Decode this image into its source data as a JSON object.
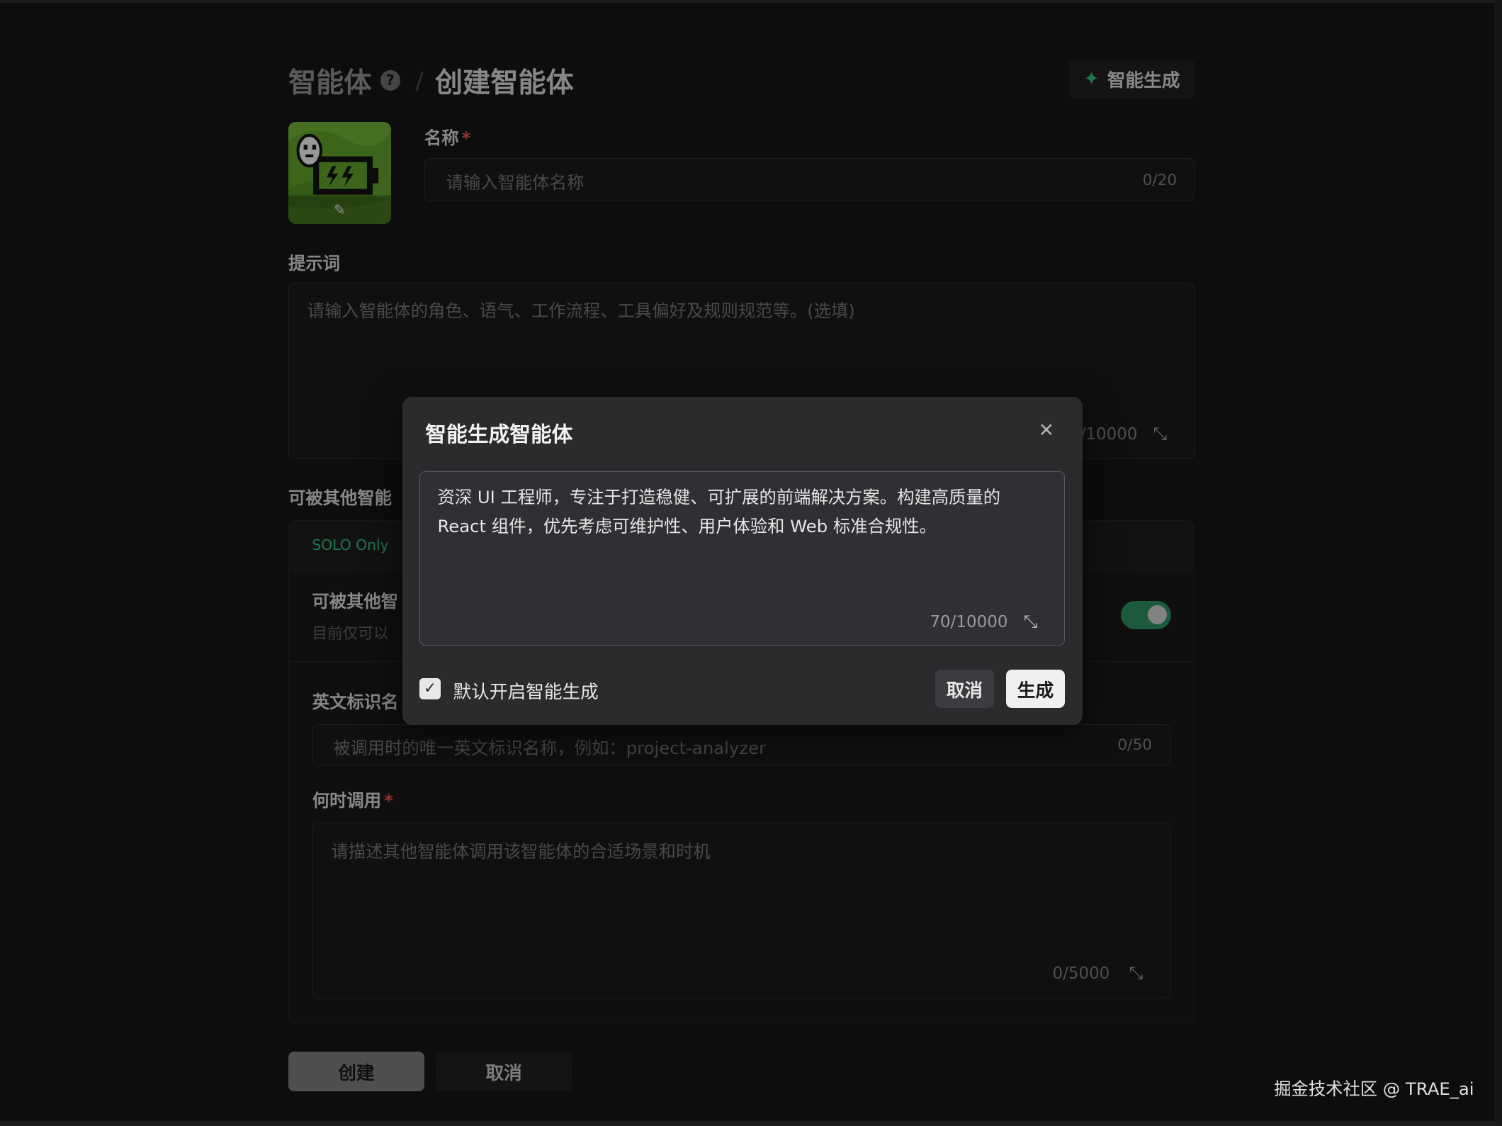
{
  "breadcrumb": {
    "parent": "智能体",
    "separator": "/",
    "current": "创建智能体",
    "help": "?"
  },
  "smart_generate_button": "智能生成",
  "avatar": {
    "edit_icon": "✎"
  },
  "name_field": {
    "label": "名称",
    "required_mark": "*",
    "placeholder": "请输入智能体名称",
    "counter": "0/20"
  },
  "prompt_field": {
    "label": "提示词",
    "placeholder": "请输入智能体的角色、语气、工作流程、工具偏好及规则规范等。(选填)",
    "counter": "/10000"
  },
  "callable_section": {
    "title": "可被其他智能",
    "badge": "SOLO Only",
    "toggle_title": "可被其他智",
    "toggle_desc": "目前仅可以",
    "toggle_on": true,
    "english_id": {
      "label": "英文标识名",
      "placeholder": "被调用时的唯一英文标识名称，例如：project-analyzer",
      "counter": "0/50"
    },
    "when_to_call": {
      "label": "何时调用",
      "required_mark": "*",
      "placeholder": "请描述其他智能体调用该智能体的合适场景和时机",
      "counter": "0/5000"
    }
  },
  "footer": {
    "create_label": "创建",
    "cancel_label": "取消"
  },
  "modal": {
    "title": "智能生成智能体",
    "close_icon": "✕",
    "text": "资深 UI 工程师，专注于打造稳健、可扩展的前端解决方案。构建高质量的 React 组件，优先考虑可维护性、用户体验和 Web 标准合规性。",
    "counter": "70/10000",
    "checkbox_checked": true,
    "checkbox_label": "默认开启智能生成",
    "cancel_label": "取消",
    "generate_label": "生成"
  },
  "watermark": "掘金技术社区 @ TRAE_ai",
  "colors": {
    "accent_green": "#2fb87a",
    "required_red": "#e0514f",
    "background": "#141414"
  }
}
